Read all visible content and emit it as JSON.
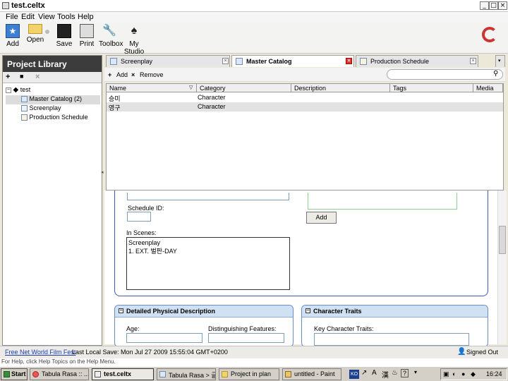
{
  "window": {
    "title": "test.celtx"
  },
  "menu": [
    "File",
    "Edit",
    "View",
    "Tools",
    "Help"
  ],
  "toolbar": {
    "add": "Add",
    "open": "Open",
    "save": "Save",
    "print": "Print",
    "toolbox": "Toolbox",
    "mystudio": "My Studio"
  },
  "library": {
    "title": "Project Library",
    "root": "test",
    "items": [
      "Master Catalog (2)",
      "Screenplay",
      "Production Schedule"
    ]
  },
  "tabs": [
    "Screenplay",
    "Master Catalog",
    "Production Schedule"
  ],
  "catalog": {
    "add": "Add",
    "remove": "Remove",
    "columns": [
      "Name",
      "Category",
      "Description",
      "Tags",
      "Media"
    ],
    "rows": [
      {
        "name": "승미",
        "category": "Character"
      },
      {
        "name": "영구",
        "category": "Character"
      }
    ]
  },
  "form": {
    "schedule_id_label": "Schedule ID:",
    "add_button": "Add",
    "in_scenes_label": "In Scenes:",
    "scenes_text": "Screenplay",
    "scene_line": "1. EXT. 벌판-DAY",
    "physical_title": "Detailed Physical Description",
    "age_label": "Age:",
    "features_label": "Distinguishing Features:",
    "traits_title": "Character Traits",
    "key_traits_label": "Key Character Traits:"
  },
  "status": {
    "link": "Free Net World Film Fest",
    "save_text": "Last Local Save: Mon Jul 27 2009 15:55:04 GMT+0200",
    "signed": "Signed Out",
    "help_text": "For Help, click Help Topics on the Help Menu."
  },
  "taskbar": {
    "start": "Start",
    "tasks": [
      "Tabula Rasa :: ...",
      "test.celtx",
      "Tabula Rasa > 글...",
      "Project in plan",
      "untitled - Paint"
    ],
    "lang": "KO",
    "clock": "16:24"
  }
}
